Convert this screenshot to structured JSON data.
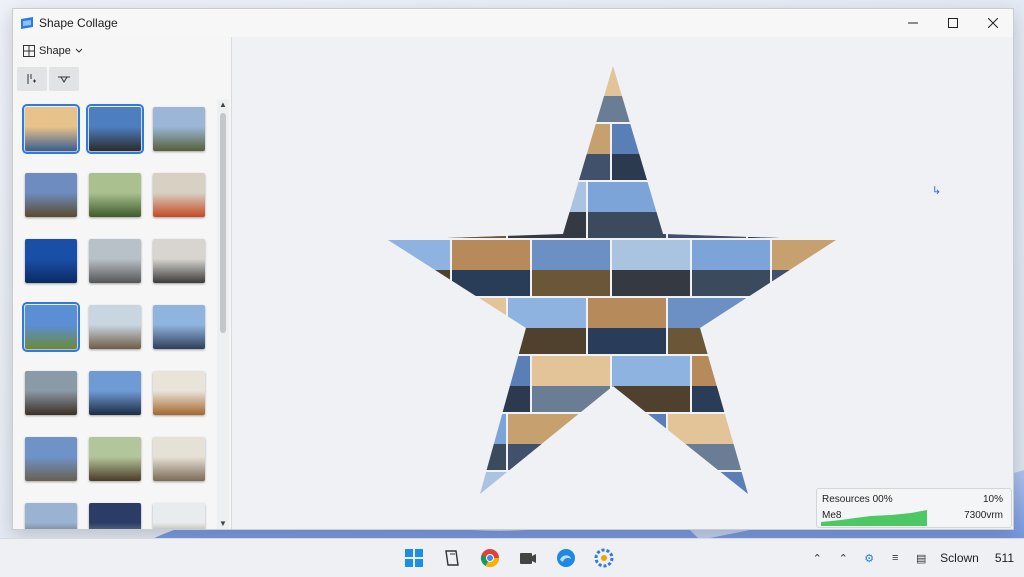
{
  "window": {
    "title": "Shape Collage"
  },
  "toolbar": {
    "shape_label": "Shape"
  },
  "thumbnails": {
    "selected_indices": [
      0,
      1,
      9
    ]
  },
  "widget": {
    "resources_label": "Resources 00%",
    "resources_value": "10%",
    "mem_label": "Me8",
    "mem_value": "7300vrm"
  },
  "taskbar": {
    "tray_text": "Sclown",
    "clock": "511"
  },
  "colors": {
    "accent": "#2d7be0",
    "graph": "#2fbf4a"
  }
}
